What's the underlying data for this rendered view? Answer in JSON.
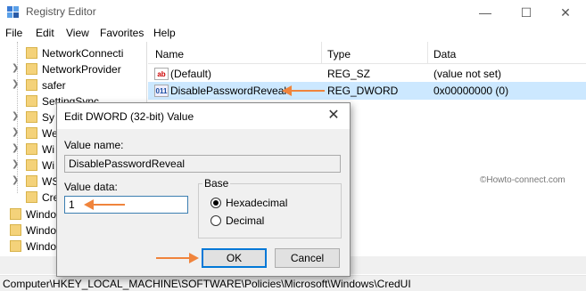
{
  "window": {
    "title": "Registry Editor",
    "minimize": "—",
    "maximize": "☐",
    "close": "✕"
  },
  "menu": [
    "File",
    "Edit",
    "View",
    "Favorites",
    "Help"
  ],
  "tree": {
    "items": [
      {
        "label": "NetworkConnecti",
        "expandable": false
      },
      {
        "label": "NetworkProvider",
        "expandable": true
      },
      {
        "label": "safer",
        "expandable": true
      },
      {
        "label": "SettingSync",
        "expandable": false
      },
      {
        "label": "Sy",
        "expandable": true
      },
      {
        "label": "We",
        "expandable": true
      },
      {
        "label": "Wi",
        "expandable": true
      },
      {
        "label": "Wi",
        "expandable": true
      },
      {
        "label": "WS",
        "expandable": true
      },
      {
        "label": "Cre",
        "expandable": false
      },
      {
        "label": "Windo",
        "expandable": true
      },
      {
        "label": "Windo",
        "expandable": true
      },
      {
        "label": "Windo",
        "expandable": true
      }
    ]
  },
  "list": {
    "headers": [
      "Name",
      "Type",
      "Data"
    ],
    "rows": [
      {
        "icon": "ab",
        "name": "(Default)",
        "type": "REG_SZ",
        "data": "(value not set)",
        "selected": false
      },
      {
        "icon": "bin",
        "name": "DisablePasswordReveal",
        "type": "REG_DWORD",
        "data": "0x00000000 (0)",
        "selected": true
      }
    ]
  },
  "watermark": "©Howto-connect.com",
  "statusbar": "Computer\\HKEY_LOCAL_MACHINE\\SOFTWARE\\Policies\\Microsoft\\Windows\\CredUI",
  "dialog": {
    "title": "Edit DWORD (32-bit) Value",
    "close": "✕",
    "value_name_label": "Value name:",
    "value_name": "DisablePasswordReveal",
    "value_data_label": "Value data:",
    "value_data": "1",
    "base_label": "Base",
    "base_options": [
      "Hexadecimal",
      "Decimal"
    ],
    "base_selected": "Hexadecimal",
    "ok_label": "OK",
    "cancel_label": "Cancel"
  },
  "colors": {
    "arrow": "#f0843c",
    "selection": "#cce8ff",
    "default_button_border": "#0078d7"
  }
}
